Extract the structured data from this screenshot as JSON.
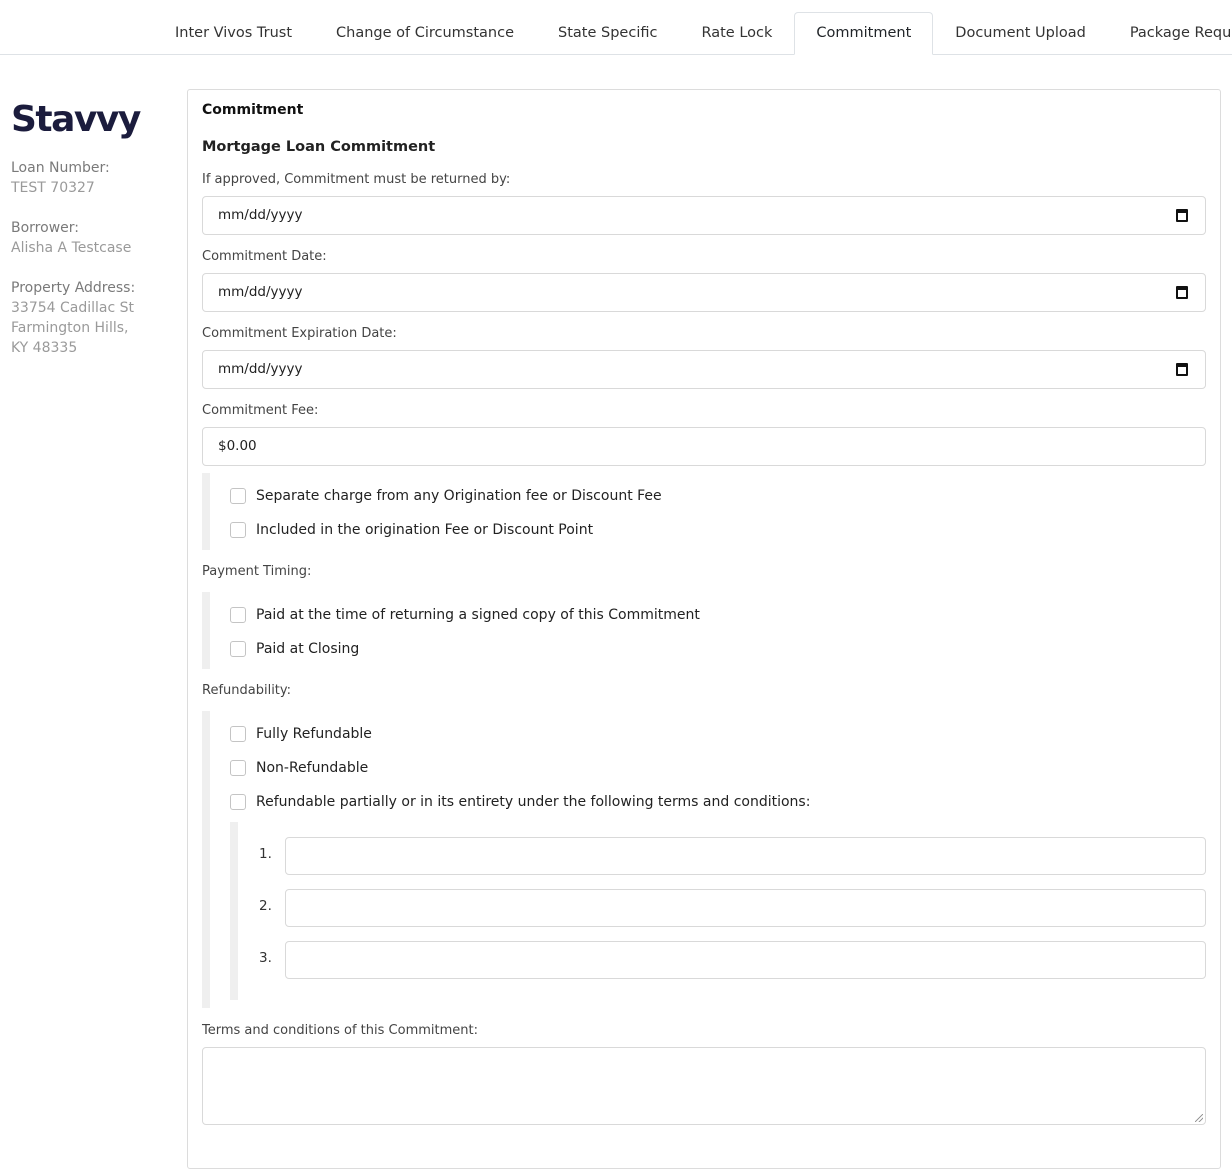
{
  "tabs": [
    {
      "label": "Inter Vivos Trust"
    },
    {
      "label": "Change of Circumstance"
    },
    {
      "label": "State Specific"
    },
    {
      "label": "Rate Lock"
    },
    {
      "label": "Commitment",
      "active": true
    },
    {
      "label": "Document Upload"
    },
    {
      "label": "Package Request"
    }
  ],
  "sidebar": {
    "logo": "Stavvy",
    "loan_number_label": "Loan Number:",
    "loan_number": "TEST 70327",
    "borrower_label": "Borrower:",
    "borrower": "Alisha A Testcase",
    "property_label": "Property Address:",
    "address_line1": "33754 Cadillac St",
    "address_line2": "Farmington Hills,",
    "address_line3": "KY 48335"
  },
  "card": {
    "title": "Commitment",
    "section_title": "Mortgage Loan Commitment",
    "return_by_label": "If approved, Commitment must be returned by:",
    "return_by_value": "mm/dd/yyyy",
    "commitment_date_label": "Commitment Date:",
    "commitment_date_value": "mm/dd/yyyy",
    "expiration_date_label": "Commitment Expiration Date:",
    "expiration_date_value": "mm/dd/yyyy",
    "fee_label": "Commitment Fee:",
    "fee_value": "$0.00",
    "fee_options": [
      "Separate charge from any Origination fee or Discount Fee",
      "Included in the origination Fee or Discount Point"
    ],
    "payment_timing_label": "Payment Timing:",
    "payment_options": [
      "Paid at the time of returning a signed copy of this Commitment",
      "Paid at Closing"
    ],
    "refundability_label": "Refundability:",
    "refund_options": [
      "Fully Refundable",
      "Non-Refundable",
      "Refundable partially or in its entirety under the following terms and conditions:"
    ],
    "refund_terms": [
      "1.",
      "2.",
      "3."
    ],
    "terms_label": "Terms and conditions of this Commitment:"
  },
  "colors": {
    "logo": "#1b1c3d",
    "border": "#dee2e6",
    "group_bar": "#efefef"
  }
}
